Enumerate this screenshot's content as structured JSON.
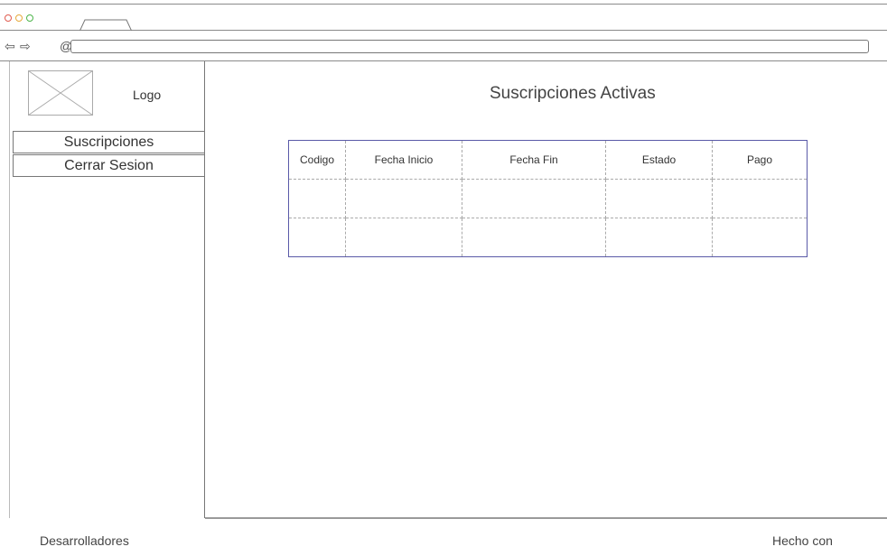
{
  "browser": {
    "back_icon": "arrow-left-outline-icon",
    "forward_icon": "arrow-right-outline-icon",
    "reload_icon": "reload-icon",
    "url": ""
  },
  "sidebar": {
    "logo_label": "Logo",
    "menu": [
      {
        "label": "Suscripciones"
      },
      {
        "label": "Cerrar Sesion"
      }
    ]
  },
  "main": {
    "title": "Suscripciones Activas",
    "table": {
      "headers": [
        "Codigo",
        "Fecha Inicio",
        "Fecha Fin",
        "Estado",
        "Pago"
      ],
      "rows": [
        [
          "",
          "",
          "",
          "",
          ""
        ],
        [
          "",
          "",
          "",
          "",
          ""
        ]
      ]
    }
  },
  "footer": {
    "left": "Desarrolladores",
    "right": "Hecho con"
  },
  "colors": {
    "table_border": "#5a5aa8",
    "window_dot_red": "#e05a4e",
    "window_dot_yellow": "#e6a93b",
    "window_dot_green": "#4cb54a"
  }
}
